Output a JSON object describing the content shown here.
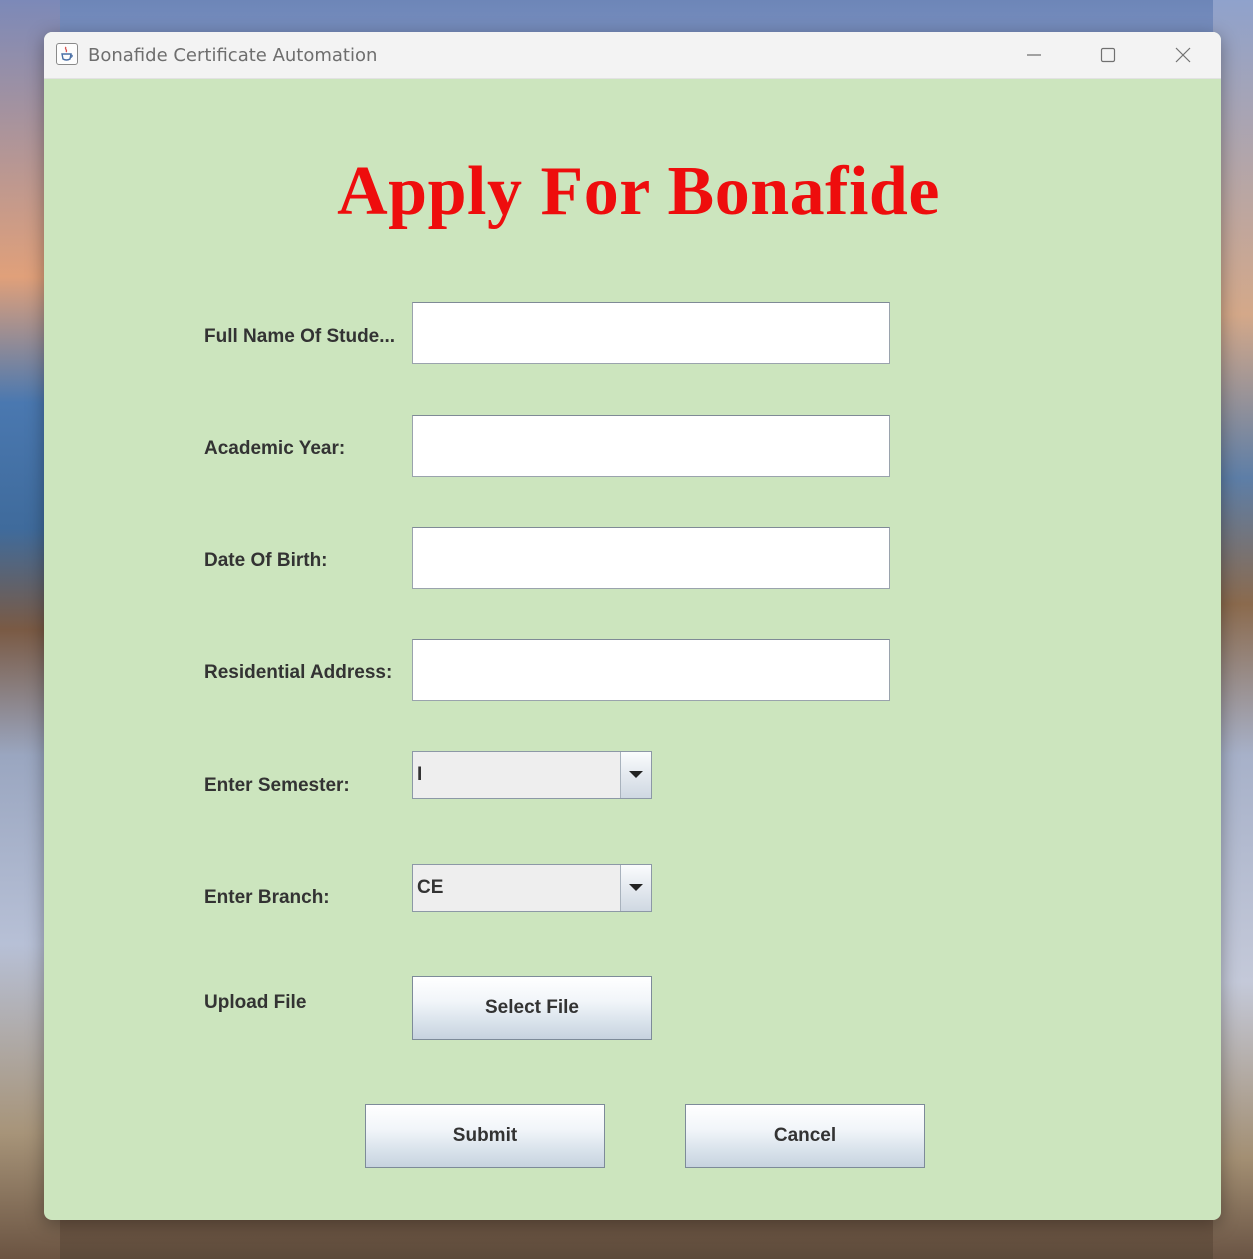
{
  "window": {
    "title": "Bonafide Certificate Automation"
  },
  "form": {
    "heading": "Apply For Bonafide",
    "fields": [
      {
        "label": "Full Name Of Stude...",
        "value": ""
      },
      {
        "label": "Academic Year:",
        "value": ""
      },
      {
        "label": "Date Of Birth:",
        "value": ""
      },
      {
        "label": "Residential Address:",
        "value": ""
      }
    ],
    "semester": {
      "label": "Enter Semester:",
      "value": "I"
    },
    "branch": {
      "label": "Enter Branch:",
      "value": "CE"
    },
    "upload": {
      "label": "Upload File",
      "button": "Select File"
    },
    "submit_label": "Submit",
    "cancel_label": "Cancel"
  },
  "colors": {
    "heading": "#ee0d0d",
    "form_background": "#cce5be",
    "label_text": "#333333"
  },
  "icons": {
    "app": "java-cup-icon",
    "minimize": "minimize-icon",
    "maximize": "maximize-icon",
    "close": "close-icon",
    "dropdown": "chevron-down-icon"
  }
}
